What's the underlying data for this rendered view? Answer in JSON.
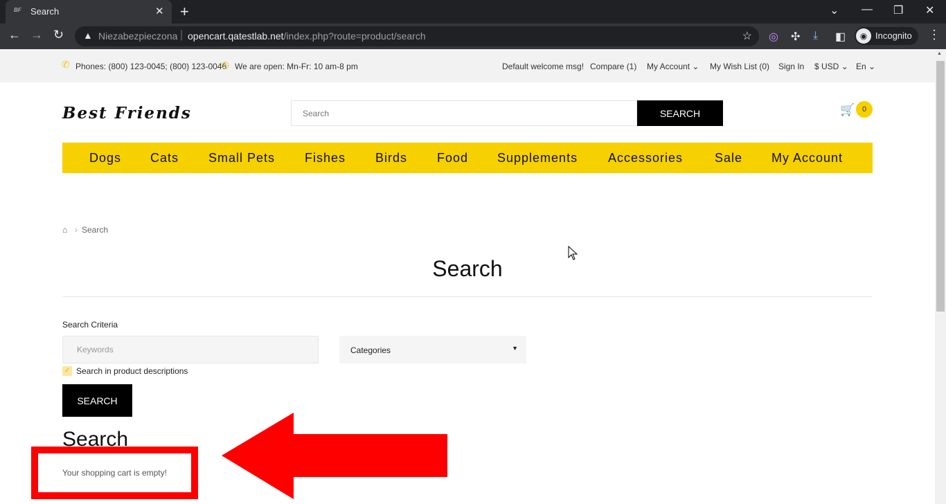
{
  "browser": {
    "tab_title": "Search",
    "tab_favicon": "BF",
    "security_label": "Niezabezpieczona",
    "url_domain": "opencart.qatestlab.net",
    "url_path": "/index.php?route=product/search",
    "profile_label": "Incognito"
  },
  "topbar": {
    "phones": "Phones: (800) 123-0045; (800) 123-0046",
    "hours": "We are open: Mn-Fr: 10 am-8 pm",
    "welcome": "Default welcome msg!",
    "compare": "Compare (1)",
    "my_account": "My Account",
    "wish_list": "My Wish List (0)",
    "sign_in": "Sign In",
    "currency": "$ USD",
    "language": "En"
  },
  "header": {
    "logo": "Best Friends",
    "search_placeholder": "Search",
    "search_button": "SEARCH",
    "cart_count": "0"
  },
  "menu": {
    "items": [
      "Dogs",
      "Cats",
      "Small Pets",
      "Fishes",
      "Birds",
      "Food",
      "Supplements",
      "Accessories",
      "Sale",
      "My Account"
    ]
  },
  "breadcrumb": {
    "current": "Search"
  },
  "main": {
    "title": "Search",
    "criteria_label": "Search Criteria",
    "keywords_placeholder": "Keywords",
    "categories_label": "Categories",
    "description_checkbox_label": "Search in product descriptions",
    "search_button": "SEARCH",
    "results_heading": "Search",
    "empty_message": "Your shopping cart is empty!"
  },
  "colors": {
    "accent": "#f7d000",
    "annotation": "#ff0000"
  }
}
